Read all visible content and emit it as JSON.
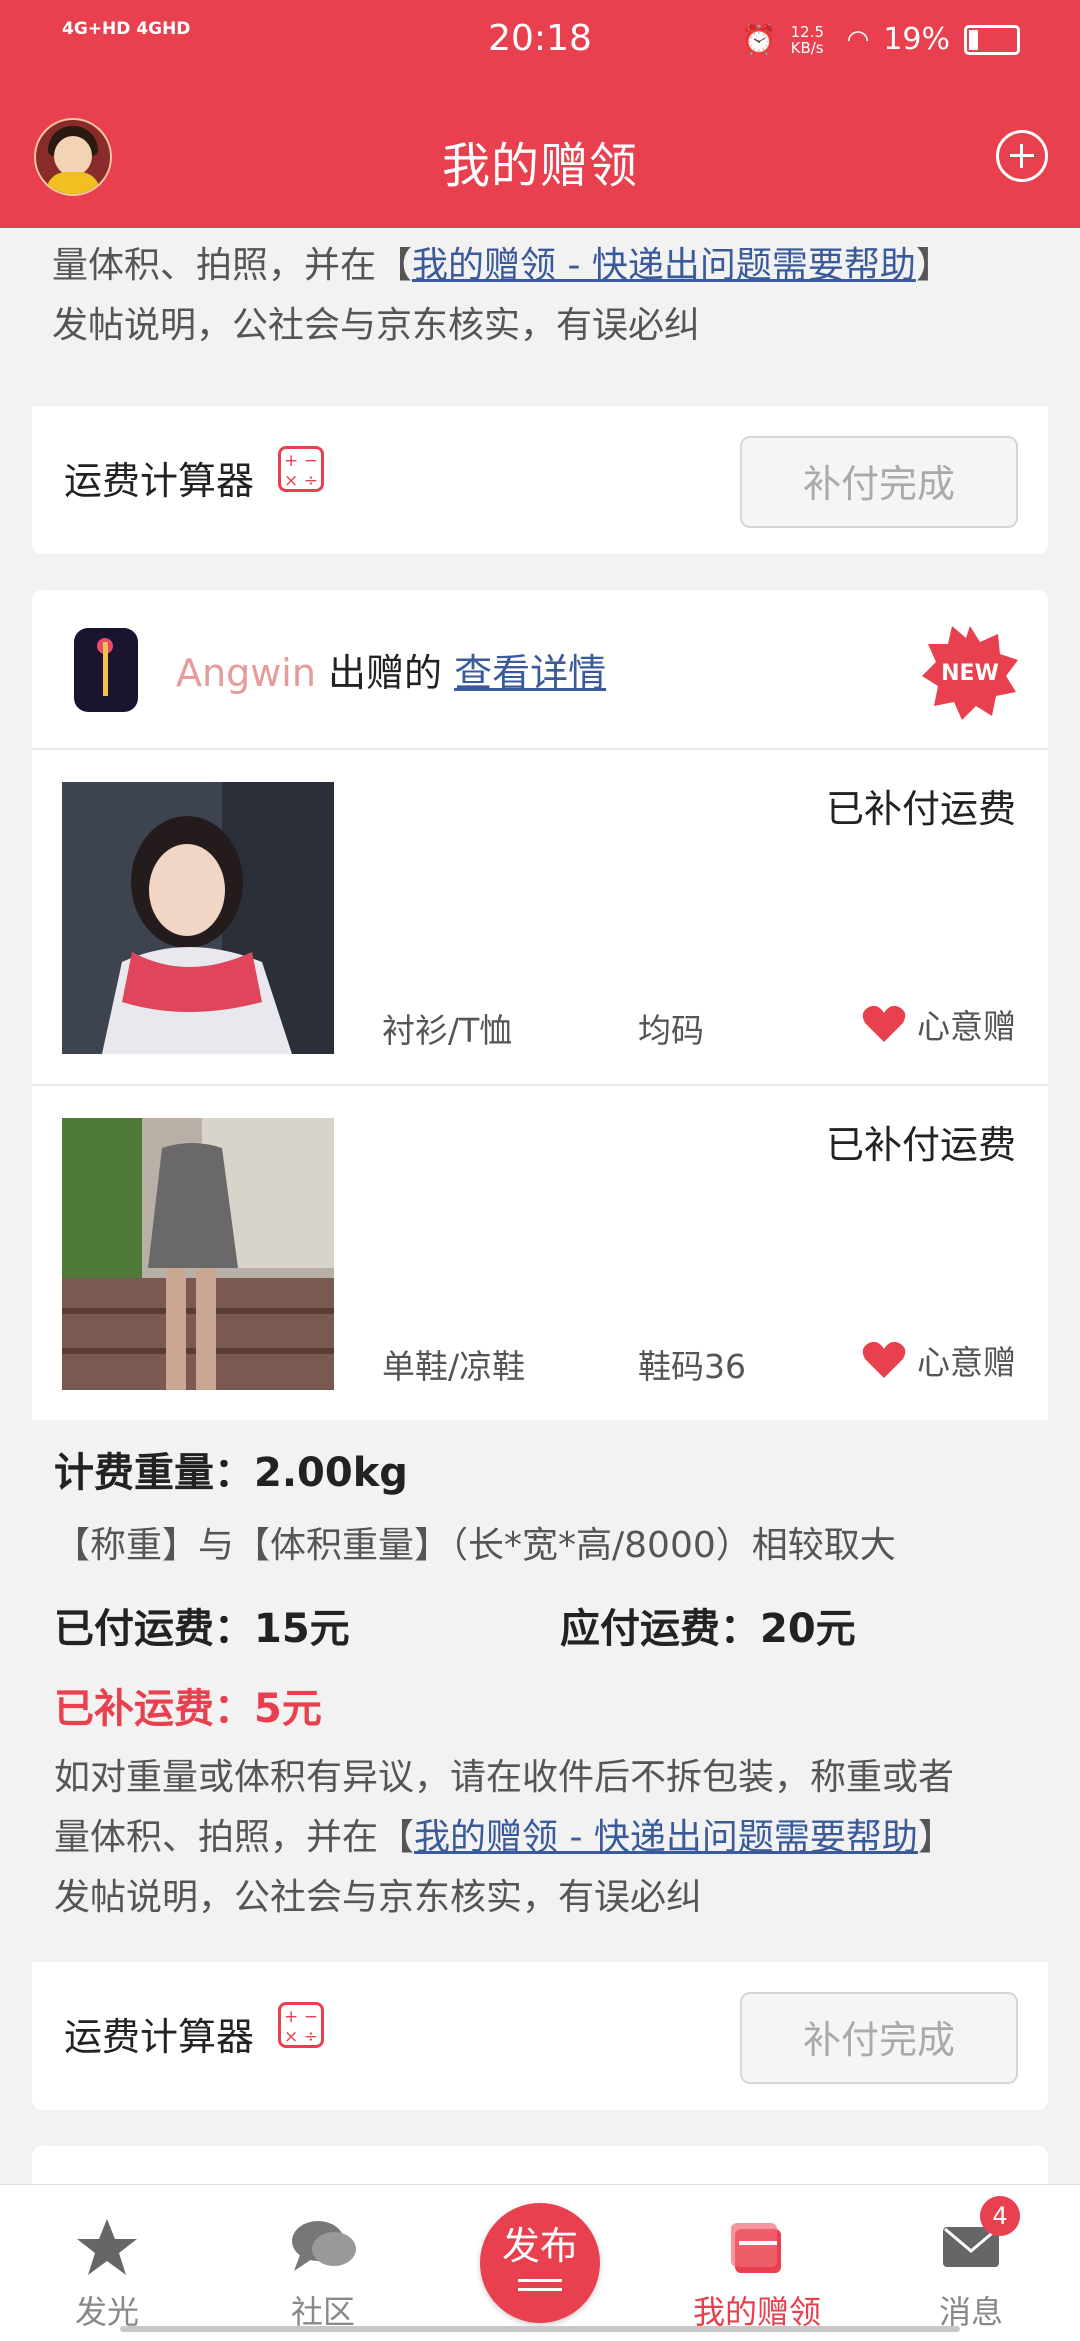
{
  "status_bar": {
    "signal": "4G+HD 4GHD",
    "time": "20:18",
    "net_speed": "12.5 KB/s",
    "battery": "19%"
  },
  "navbar": {
    "title": "我的赠领"
  },
  "top_partial": {
    "notice_line1_start": "量体积、拍照，并在【",
    "notice_link": "我的赠领 - 快递出问题需要帮助",
    "notice_line1_end": "】",
    "notice_line2": "发帖说明，公社会与京东核实，有误必纠",
    "calc_label": "运费计算器",
    "button": "补付完成"
  },
  "card": {
    "giver_name": "Angwin",
    "giver_suffix": " 出赠的 ",
    "detail_link": "查看详情",
    "new_badge": "NEW",
    "items": [
      {
        "status": "已补付运费",
        "category": "衬衫/T恤",
        "size": "均码",
        "gift": "心意赠"
      },
      {
        "status": "已补付运费",
        "category": "单鞋/凉鞋",
        "size": "鞋码36",
        "gift": "心意赠"
      }
    ],
    "fee": {
      "weight": "计费重量：2.00kg",
      "rule": "【称重】与【体积重量】（长*宽*高/8000）相较取大",
      "paid": "已付运费：15元",
      "due": "应付运费：20元",
      "extra": "已补运费：5元",
      "notice_line1": "如对重量或体积有异议，请在收件后不拆包装，称重或者",
      "notice_line2_start": "量体积、拍照，并在【",
      "notice_link": "我的赠领 - 快递出问题需要帮助",
      "notice_line2_end": "】",
      "notice_line3": "发帖说明，公社会与京东核实，有误必纠"
    },
    "calc_label": "运费计算器",
    "button": "补付完成"
  },
  "tabbar": {
    "tabs": [
      "发光",
      "社区",
      "我的赠领",
      "消息"
    ],
    "publish": "发布",
    "msg_badge": "4"
  },
  "colors": {
    "brand": "#e8404e",
    "link": "#3a5a9a"
  }
}
